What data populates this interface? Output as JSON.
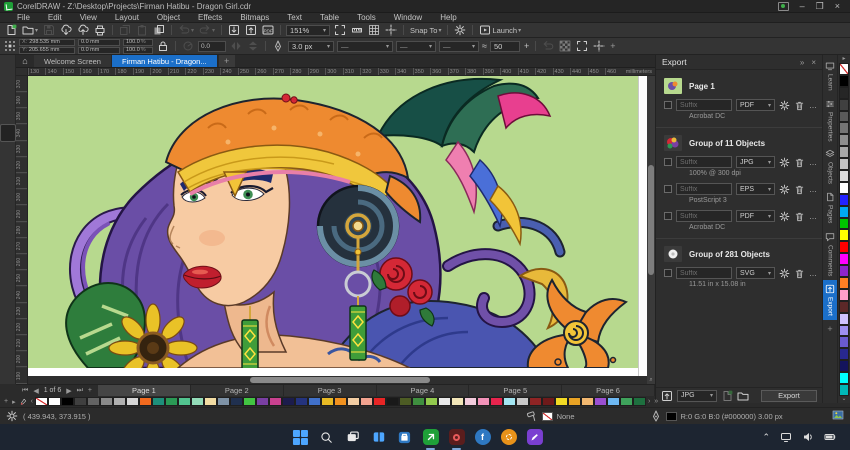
{
  "title_bar": {
    "title": "CorelDRAW - Z:\\Desktop\\Projects\\Firman Hatibu - Dragon Girl.cdr"
  },
  "menu": {
    "items": [
      "File",
      "Edit",
      "View",
      "Layout",
      "Object",
      "Effects",
      "Bitmaps",
      "Text",
      "Table",
      "Tools",
      "Window",
      "Help"
    ]
  },
  "toolbar": {
    "zoom": "151%",
    "snap_label": "Snap To",
    "launch_label": "Launch"
  },
  "property_bar": {
    "x_label": "X:",
    "y_label": "Y:",
    "x": "298.535 mm",
    "y": "205.655 mm",
    "w": "0.0 mm",
    "h": "0.0 mm",
    "scale_x": "100.0",
    "scale_y": "100.0",
    "percent": "%",
    "angle": "0.0",
    "outline_width": "3.0 px",
    "steps": "50"
  },
  "document_tabs": {
    "tabs": [
      {
        "label": "Welcome Screen",
        "active": false
      },
      {
        "label": "Firman Hatibu - Dragon...",
        "active": true
      }
    ]
  },
  "rulers": {
    "units": "millimeters",
    "horizontal_ticks": [
      "130",
      "140",
      "150",
      "160",
      "170",
      "180",
      "190",
      "200",
      "210",
      "220",
      "230",
      "240",
      "250",
      "260",
      "270",
      "280",
      "290",
      "300",
      "310",
      "320",
      "330",
      "340",
      "350",
      "360",
      "370",
      "380",
      "390",
      "400",
      "410",
      "420",
      "430",
      "440",
      "450",
      "460"
    ],
    "vertical_ticks": [
      "370",
      "360",
      "350",
      "340",
      "330",
      "320",
      "310",
      "300",
      "290",
      "280",
      "270",
      "260",
      "250",
      "240",
      "230",
      "220",
      "210",
      "200",
      "190"
    ]
  },
  "toolbox": {
    "tools": [
      {
        "name": "pick-tool",
        "icon": "cursor"
      },
      {
        "name": "shape-tool",
        "icon": "nodearrow"
      },
      {
        "name": "crop-tool",
        "icon": "crop"
      },
      {
        "name": "pan-tool",
        "icon": "hand"
      },
      {
        "name": "freehand-tool",
        "icon": "bezier",
        "active": true
      },
      {
        "name": "artistic-media-tool",
        "icon": "spiral"
      },
      {
        "name": "rectangle-tool",
        "icon": "rect"
      },
      {
        "name": "ellipse-tool",
        "icon": "ellipse"
      },
      {
        "name": "polygon-tool",
        "icon": "polygon"
      },
      {
        "name": "text-tool",
        "icon": "textA"
      },
      {
        "name": "line-tool",
        "icon": "line"
      },
      {
        "name": "dimension-tool",
        "icon": "dimension"
      },
      {
        "name": "drop-shadow-tool",
        "icon": "shadow"
      },
      {
        "name": "mesh-fill-tool",
        "icon": "checker"
      },
      {
        "name": "smart-drawing-tool",
        "icon": "pencil"
      },
      {
        "name": "color-eyedropper-tool",
        "icon": "dropper"
      },
      {
        "name": "add-tool",
        "icon": "plus"
      }
    ]
  },
  "export_panel": {
    "title": "Export",
    "groups": [
      {
        "name": "Page 1",
        "thumb": "page",
        "rows": [
          {
            "placeholder": "Suffix",
            "format": "PDF",
            "detail": "Acrobat DC"
          }
        ]
      },
      {
        "name": "Group of 11 Objects",
        "thumb": "flowers",
        "rows": [
          {
            "placeholder": "Suffix",
            "format": "JPG",
            "detail": "100% @ 300 dpi"
          },
          {
            "placeholder": "Suffix",
            "format": "EPS",
            "detail": "PostScript 3"
          },
          {
            "placeholder": "Suffix",
            "format": "PDF",
            "detail": "Acrobat DC"
          }
        ]
      },
      {
        "name": "Group of 281 Objects",
        "thumb": "whiteflower",
        "rows": [
          {
            "placeholder": "Suffix",
            "format": "SVG",
            "detail": "11.51 in x 15.08 in"
          }
        ]
      }
    ],
    "footer": {
      "format": "JPG",
      "button": "Export"
    }
  },
  "docker_tabs": {
    "active": "Export",
    "items": [
      {
        "label": "Learn",
        "icon": "dtab-learn"
      },
      {
        "label": "Properties",
        "icon": "dtab-props"
      },
      {
        "label": "Objects",
        "icon": "dtab-objects"
      },
      {
        "label": "Pages",
        "icon": "dtab-pages"
      },
      {
        "label": "Comments",
        "icon": "dtab-comments"
      },
      {
        "label": "Export",
        "icon": "dtab-export"
      }
    ]
  },
  "right_palette": {
    "colors": [
      "none",
      "#000000",
      "#262626",
      "#404040",
      "#5a5a5a",
      "#747474",
      "#8e8e8e",
      "#a8a8a8",
      "#c2c2c2",
      "#dcdcdc",
      "#ffffff",
      "#2222ff",
      "#00a8f2",
      "#00c400",
      "#ffff00",
      "#ff0000",
      "#ff00ff",
      "#8f24cc",
      "#ff7f24",
      "#ff9ecb",
      "#5c2828",
      "#cfc2ff",
      "#9e8ff2",
      "#6a5ad0",
      "#28288f",
      "#14145c",
      "#00ffff",
      "#00b8b8"
    ]
  },
  "page_nav": {
    "position": "1 of 6",
    "active": "Page 1",
    "tabs": [
      "Page 1",
      "Page 2",
      "Page 3",
      "Page 4",
      "Page 5",
      "Page 6"
    ]
  },
  "document_palette": {
    "colors": [
      "none",
      "#ffffff",
      "#000000",
      "#3f3f3f",
      "#636363",
      "#8a8a8a",
      "#b0b0b0",
      "#d6d6d6",
      "#f26a1e",
      "#1e8f7a",
      "#2a9a55",
      "#52c48f",
      "#93dcb9",
      "#f2dca3",
      "#7e92a6",
      "#20304f",
      "#42c442",
      "#7a3fa3",
      "#c9418f",
      "#1c1c4c",
      "#24337e",
      "#4070c9",
      "#e8ba24",
      "#f2921f",
      "#f2cda3",
      "#f2a38f",
      "#e82525",
      "#191919",
      "#4d5c24",
      "#3f8f3f",
      "#92c94d",
      "#e8e8e8",
      "#f2e6b8",
      "#f2cbdc",
      "#f292b8",
      "#e8244d",
      "#a3e6f2",
      "#c9c9c9",
      "#8f2424",
      "#6e1a1a",
      "#f2da24",
      "#e8a224",
      "#f2b870",
      "#9a4fd1",
      "#6eb8f2",
      "#3fa35c",
      "#1e703f"
    ]
  },
  "status_bar": {
    "coordinates": "( 439.943, 373.915 )",
    "fill_value": "None",
    "outline_value": "R:0 G:0 B:0 (#000000)  3.00 px"
  },
  "canvas": {
    "background": "#b7d98e"
  },
  "taskbar": {
    "buttons": [
      {
        "name": "start"
      },
      {
        "name": "search"
      },
      {
        "name": "task-view"
      },
      {
        "name": "snap-layouts"
      },
      {
        "name": "store"
      },
      {
        "name": "coreldraw",
        "color": "#1fa038",
        "active": true
      },
      {
        "name": "recorder",
        "color": "#5a1d1d",
        "active": true
      },
      {
        "name": "facebook",
        "color": "#2e78c2"
      },
      {
        "name": "orange-app",
        "color": "#e8921a"
      },
      {
        "name": "pen-app",
        "color": "#7a3fd1"
      }
    ]
  }
}
